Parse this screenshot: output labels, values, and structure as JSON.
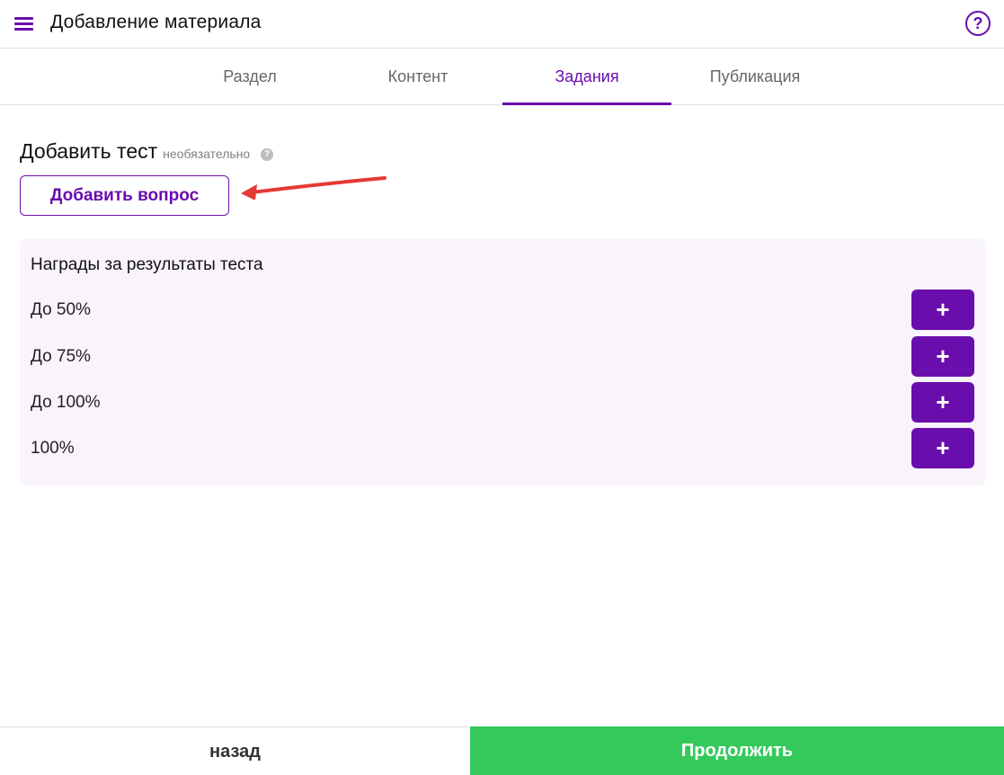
{
  "header": {
    "title": "Добавление материала",
    "menu_icon": "hamburger-menu-icon",
    "help_icon": "question-circle-icon",
    "help_glyph": "?"
  },
  "tabs": [
    {
      "label": "Раздел",
      "active": false
    },
    {
      "label": "Контент",
      "active": false
    },
    {
      "label": "Задания",
      "active": true
    },
    {
      "label": "Публикация",
      "active": false
    }
  ],
  "test_section": {
    "title": "Добавить тест",
    "optional_label": "необязательно",
    "info_icon": "info-icon",
    "info_glyph": "?",
    "add_question_label": "Добавить вопрос"
  },
  "rewards": {
    "title": "Награды за результаты теста",
    "rows": [
      {
        "label": "До 50%",
        "button": "+"
      },
      {
        "label": "До 75%",
        "button": "+"
      },
      {
        "label": "До 100%",
        "button": "+"
      },
      {
        "label": "100%",
        "button": "+"
      }
    ]
  },
  "footer": {
    "back_label": "назад",
    "continue_label": "Продолжить"
  },
  "colors": {
    "accent": "#6a0dad",
    "success": "#35c95c",
    "panel_bg": "#f9f3fc",
    "annotation_arrow": "#e53935"
  }
}
